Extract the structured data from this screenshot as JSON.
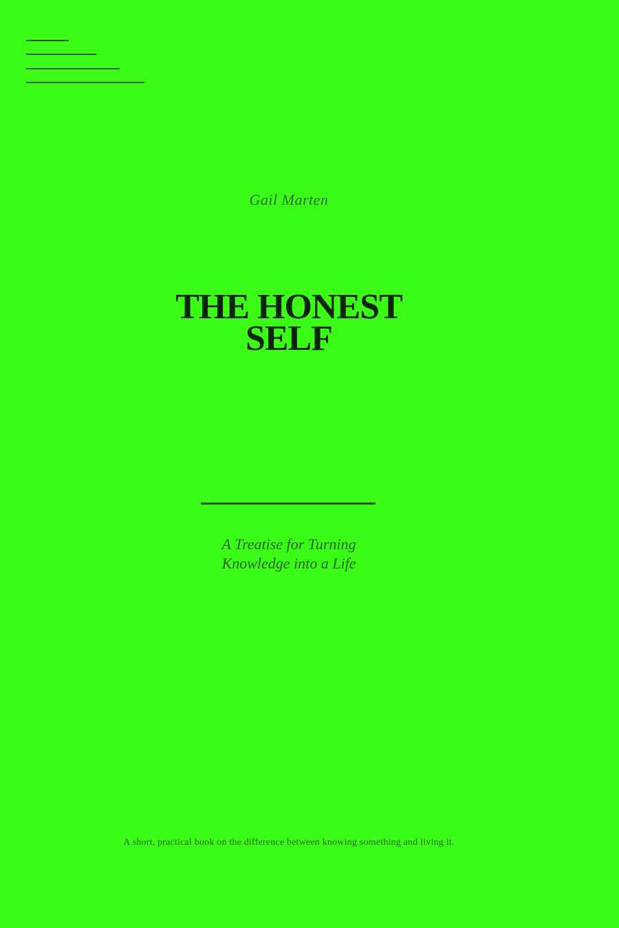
{
  "cover": {
    "background_color": "#3bfc16",
    "ink_color": "#0a2408",
    "author": "Gail Marten",
    "title_line_1": "THE HONEST",
    "title_line_2": "SELF",
    "subtitle_line_1": "A Treatise for Turning",
    "subtitle_line_2": "Knowledge into a Life",
    "blurb": "A short, practical book on the difference between knowing something and living it."
  }
}
